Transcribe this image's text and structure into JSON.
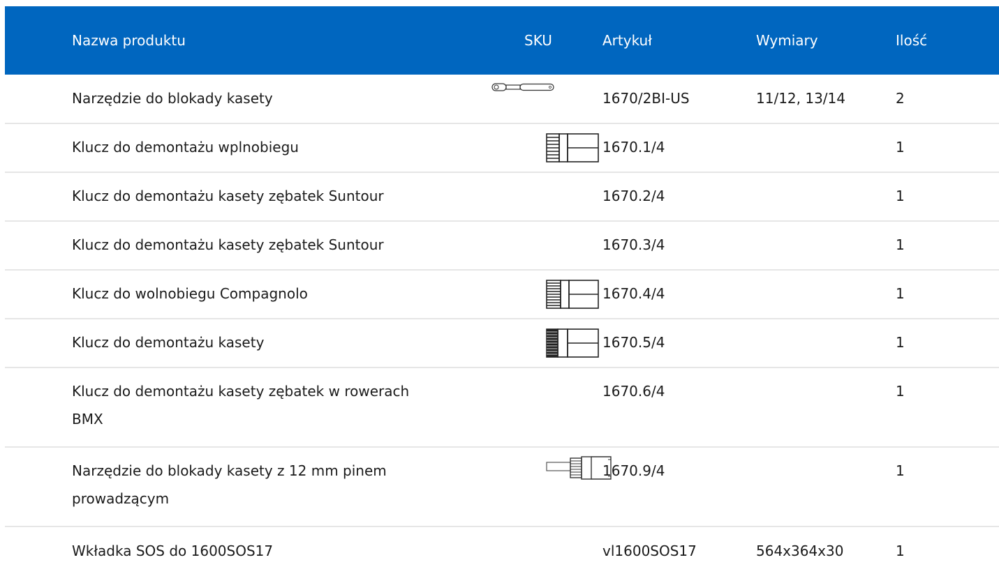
{
  "colors": {
    "header_bg": "#0066bf",
    "divider": "#e6e6e6"
  },
  "header": {
    "name": "Nazwa produktu",
    "sku": "SKU",
    "article": "Artykuł",
    "dimensions": "Wymiary",
    "quantity": "Ilość"
  },
  "rows": [
    {
      "name": "Narzędzie do blokady kasety",
      "sku_icon": "ratchet-wrench-icon",
      "article": "1670/2BI-US",
      "dimensions": "11/12, 13/14",
      "quantity": "2"
    },
    {
      "name": "Klucz do demontażu wplnobiegu",
      "sku_icon": "freewheel-remover-icon",
      "article": "1670.1/4",
      "dimensions": "",
      "quantity": "1"
    },
    {
      "name": "Klucz do demontażu kasety zębatek Suntour",
      "sku_icon": "",
      "article": "1670.2/4",
      "dimensions": "",
      "quantity": "1"
    },
    {
      "name": "Klucz do demontażu kasety zębatek Suntour",
      "sku_icon": "",
      "article": "1670.3/4",
      "dimensions": "",
      "quantity": "1"
    },
    {
      "name": "Klucz do wolnobiegu Compagnolo",
      "sku_icon": "freewheel-remover-icon",
      "article": "1670.4/4",
      "dimensions": "",
      "quantity": "1"
    },
    {
      "name": "Klucz do demontażu kasety",
      "sku_icon": "cassette-remover-icon",
      "article": "1670.5/4",
      "dimensions": "",
      "quantity": "1"
    },
    {
      "name": "Klucz do demontażu kasety zębatek w rowerach BMX",
      "sku_icon": "",
      "article": "1670.6/4",
      "dimensions": "",
      "quantity": "1"
    },
    {
      "name": "Narzędzie do blokady kasety z 12 mm pinem prowadzącym",
      "sku_icon": "pin-lockring-tool-icon",
      "article": "1670.9/4",
      "dimensions": "",
      "quantity": "1"
    },
    {
      "name": "Wkładka SOS do 1600SOS17",
      "sku_icon": "",
      "article": "vl1600SOS17",
      "dimensions": "564x364x30",
      "quantity": "1"
    }
  ]
}
